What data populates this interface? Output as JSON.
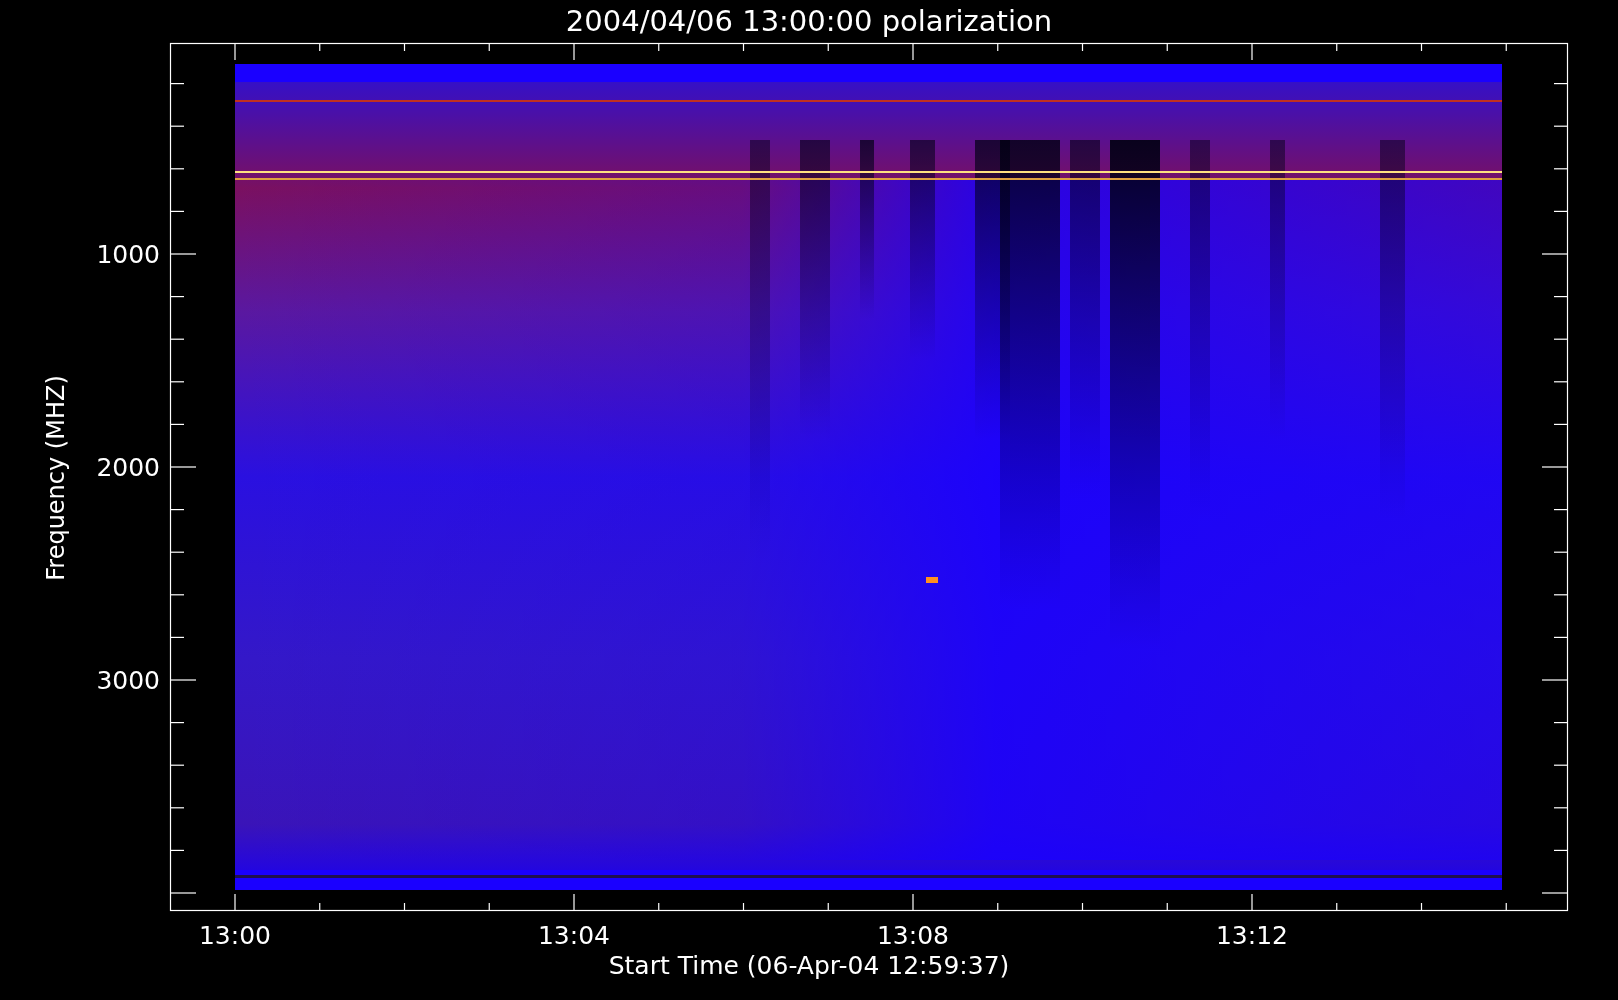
{
  "title": "2004/04/06 13:00:00 polarization",
  "y_axis": {
    "label": "Frequency (MHZ)",
    "ticks": [
      "1000",
      "2000",
      "3000"
    ]
  },
  "x_axis": {
    "label": "Start Time (06-Apr-04 12:59:37)",
    "ticks": [
      "13:00",
      "13:04",
      "13:08",
      "13:12"
    ]
  }
}
